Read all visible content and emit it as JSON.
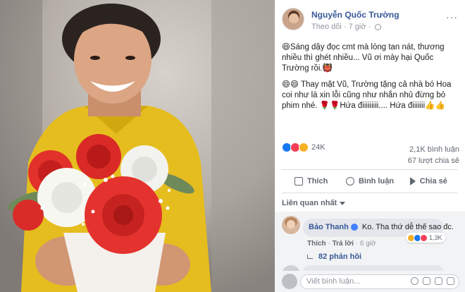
{
  "post": {
    "author": "Nguyễn Quốc Trường",
    "follow": "Theo dõi",
    "separator": "·",
    "time": "7 giờ",
    "more": "···",
    "paragraphs": [
      "😆Sáng dậy đọc cmt mà lòng tan nát, thương nhiều thì ghét nhiều... Vũ ơi mày hại Quốc Trường rồi.👹",
      "😄😄 Thay mặt Vũ, Trường tặng cả nhà bó Hoa coi như là xin lỗi cũng như nhắn nhủ đừng bỏ phim nhé. 🌹🌹Hứa điiiiiiiii.... Hứa điiiiiii👍👍"
    ]
  },
  "stats": {
    "reaction_count": "24K",
    "comments": "2,1K bình luận",
    "shares": "67 lượt chia sẻ"
  },
  "actions": {
    "like": "Thích",
    "comment": "Bình luận",
    "share": "Chia sẻ"
  },
  "filter": "Liên quan nhất",
  "comment": {
    "name": "Bảo Thanh",
    "text": "Ko. Tha thứ dễ thế sao đc.",
    "like": "Thích",
    "reply": "Trả lời",
    "time": "6 giờ",
    "react_count": "1,3K",
    "replies": "82 phản hồi"
  },
  "composer": {
    "placeholder": "Viết bình luận..."
  },
  "colors": {
    "link": "#385898",
    "like": "#1877f2",
    "love": "#f33e58",
    "haha": "#f7b125"
  }
}
